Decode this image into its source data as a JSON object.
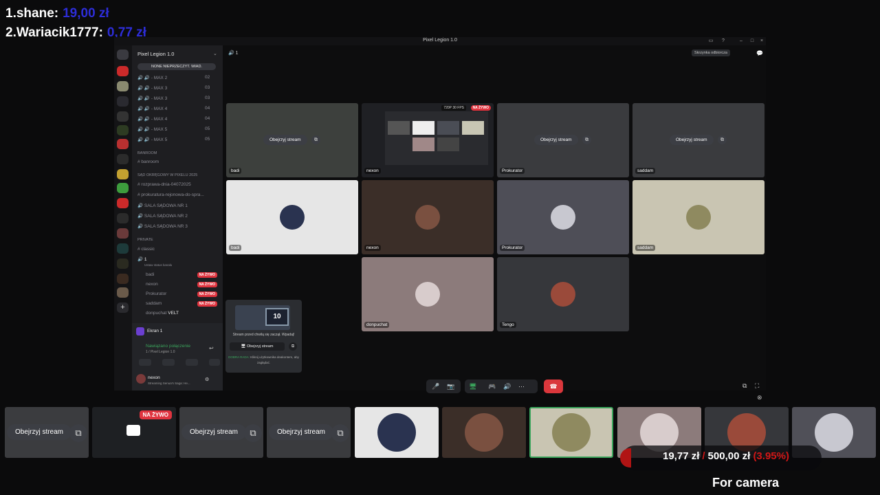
{
  "leaderboard": [
    {
      "rank": "1.",
      "name": "shane:",
      "amount": "19,00 zł"
    },
    {
      "rank": "2.",
      "name": "Wariacik1777:",
      "amount": "0,77 zł"
    }
  ],
  "window": {
    "title": "Pixel Legion 1.0",
    "top_right_tooltip": "Skrzynka odbiorcza",
    "channel_header": "1"
  },
  "sidebar": {
    "server_name": "Pixel Legion 1.0",
    "banner": "NONE NIEPRZECZYT. WIAD.",
    "voice_max": [
      {
        "label": "- MAX 2",
        "count": "02"
      },
      {
        "label": "- MAX 3",
        "count": "03"
      },
      {
        "label": "- MAX 3",
        "count": "03"
      },
      {
        "label": "- MAX 4",
        "count": "04"
      },
      {
        "label": "- MAX 4",
        "count": "04"
      },
      {
        "label": "- MAX 5",
        "count": "05"
      },
      {
        "label": "- MAX 5",
        "count": "05"
      }
    ],
    "banroom_cat": "BANROOM",
    "banroom": "banroom",
    "court_cat": "SĄD OKRĘGOWY W PIXELU 2025",
    "court_channels": [
      "rozprawa-dnia-04072025",
      "prokuratura-rejonowa-do-spra...",
      "SALA SĄDOWA NR 1",
      "SALA SĄDOWA NR 2",
      "SALA SĄDOWA NR 3"
    ],
    "private_cat": "PRIVATE",
    "private_channels": [
      "classic",
      "1"
    ],
    "voice_subtitle": "Ustaw status kanału",
    "members": [
      {
        "name": "badi",
        "badge": "NA ŻYWO"
      },
      {
        "name": "nexon",
        "badge": "NA ŻYWO"
      },
      {
        "name": "Prokurator",
        "badge": "NA ŻYWO"
      },
      {
        "name": "saddam",
        "badge": "NA ŻYWO"
      },
      {
        "name": "donpuchat",
        "badge": "VELT"
      }
    ],
    "screen_panel": "Ekran 1",
    "connection": "Nawiązano połączenie",
    "connection_sub": "1 / Pixel Legion 1.0",
    "user": "nexon",
    "user_status": "Streaming Senua's Saga: He..."
  },
  "grid": {
    "watch_label": "Obejrzyj stream",
    "stream_badge": "720P 30 FPS",
    "live_badge": "NA ŻYWO",
    "streams": [
      "badi",
      "nexon",
      "Prokurator",
      "saddam"
    ],
    "cams": [
      "badi",
      "nexon",
      "Prokurator",
      "saddam",
      "donpuchat",
      "Tengo"
    ]
  },
  "popup": {
    "number": "10",
    "text": "Stream przed chwilą się zaczął. Wpadaj!",
    "button": "Obejrzyj stream",
    "tip_title": "DOBRA RADA:",
    "tip_text": "Kliknij użytkownika deakontem, aby zagłądać."
  },
  "strip": {
    "watch_label": "Obejrzyj stream",
    "live_badge": "NA ŻYWO"
  },
  "goal": {
    "current": "19,77 zł",
    "sep": "/",
    "target": "500,00 zł",
    "percent": "(3.95%)"
  },
  "camera_label": "For camera",
  "colors": {
    "accent_live": "#e0343f",
    "donor_amount": "#2d2dd8",
    "goal_red": "#d01616",
    "selected_border": "#3ba55c"
  }
}
